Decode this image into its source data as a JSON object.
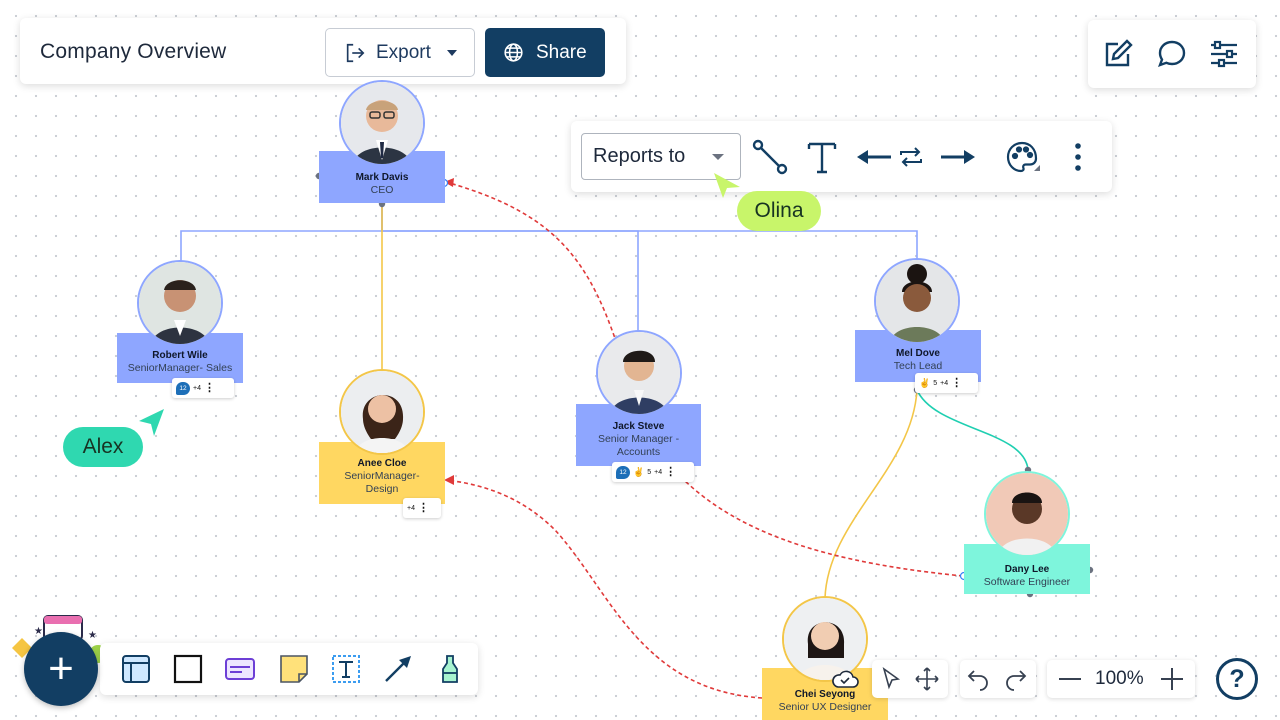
{
  "topbar": {
    "title": "Company Overview",
    "export_label": "Export",
    "share_label": "Share"
  },
  "top_right_icons": [
    "edit-icon",
    "comment-icon",
    "settings-sliders-icon"
  ],
  "connector_toolbar": {
    "relation_select": "Reports to",
    "icons": [
      "connector-icon",
      "text-icon",
      "arrow-left-icon",
      "swap-icon",
      "arrow-right-icon",
      "palette-icon",
      "more-icon"
    ]
  },
  "cursors": {
    "olina": "Olina",
    "alex": "Alex"
  },
  "nodes": {
    "mark": {
      "name": "Mark  Davis",
      "role": "CEO"
    },
    "robert": {
      "name": "Robert Wile",
      "role": "SeniorManager- Sales",
      "badge": "12",
      "more": "+4"
    },
    "anee": {
      "name": "Anee Cloe",
      "role1": "SeniorManager-",
      "role2": "Design",
      "more": "+4"
    },
    "jack": {
      "name": "Jack Steve",
      "role1": "Senior Manager -",
      "role2": "Accounts",
      "badge": "12",
      "likes": "5",
      "more": "+4"
    },
    "mel": {
      "name": "Mel Dove",
      "role": "Tech Lead",
      "likes": "5",
      "more": "+4"
    },
    "dany": {
      "name": "Dany Lee",
      "role": "Software Engineer"
    },
    "chei": {
      "name": "Chei Seyong",
      "role": "Senior UX Designer"
    }
  },
  "bottom_toolbar": {
    "icons": [
      "frame-icon",
      "rectangle-icon",
      "card-icon",
      "sticky-note-icon",
      "text-box-icon",
      "arrow-icon",
      "marker-icon"
    ]
  },
  "zoom": {
    "value": "100%"
  },
  "help_label": "?",
  "colors": {
    "brand": "#123e63",
    "blue_node": "#8ea6ff",
    "yellow_node": "#ffd761",
    "teal_node": "#7ef5dc",
    "reports_line": "#e03a3a",
    "olina_cursor": "#c8f56a",
    "alex_cursor": "#2fd8b0"
  }
}
